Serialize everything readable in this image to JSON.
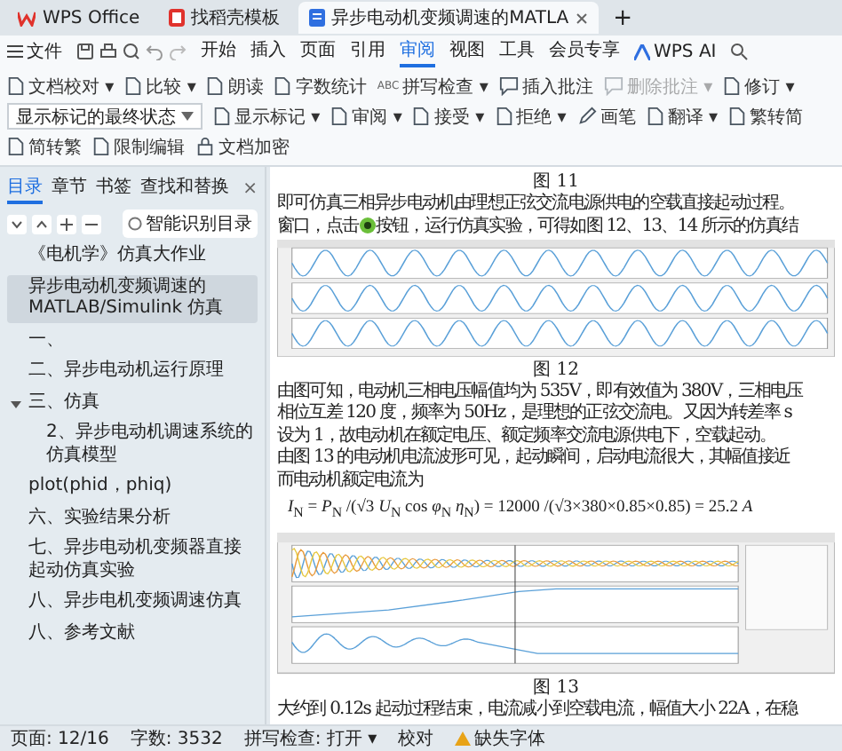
{
  "tabs": [
    {
      "kind": "home",
      "label": "WPS Office",
      "selected": false
    },
    {
      "kind": "template",
      "label": "找稻壳模板",
      "selected": false
    },
    {
      "kind": "document",
      "label": "异步电动机变频调速的MATLA",
      "selected": true
    }
  ],
  "tab_add": "+",
  "menu": {
    "file": "文件",
    "items": [
      {
        "label": "开始",
        "selected": false
      },
      {
        "label": "插入",
        "selected": false
      },
      {
        "label": "页面",
        "selected": false
      },
      {
        "label": "引用",
        "selected": false
      },
      {
        "label": "审阅",
        "selected": true
      },
      {
        "label": "视图",
        "selected": false
      },
      {
        "label": "工具",
        "selected": false
      },
      {
        "label": "会员专享",
        "selected": false
      }
    ],
    "ai": "WPS AI"
  },
  "ribbon": [
    {
      "kind": "button",
      "label": "文档校对 ▾",
      "disabled": false
    },
    {
      "kind": "button",
      "label": "比较 ▾",
      "disabled": false
    },
    {
      "kind": "button",
      "label": "朗读",
      "disabled": false
    },
    {
      "kind": "button",
      "label": "字数统计",
      "disabled": false
    },
    {
      "kind": "abc",
      "icon_text": "ABC",
      "label": "拼写检查 ▾",
      "disabled": false
    },
    {
      "kind": "comment",
      "label": "插入批注",
      "disabled": false
    },
    {
      "kind": "comment",
      "label": "删除批注 ▾",
      "disabled": true
    },
    {
      "kind": "button",
      "label": "修订 ▾",
      "disabled": false
    },
    {
      "kind": "select",
      "value": "显示标记的最终状态"
    },
    {
      "kind": "button",
      "label": "显示标记 ▾",
      "disabled": false
    },
    {
      "kind": "button",
      "label": "审阅 ▾",
      "disabled": false
    },
    {
      "kind": "button",
      "label": "接受 ▾",
      "disabled": false
    },
    {
      "kind": "button",
      "label": "拒绝 ▾",
      "disabled": false
    },
    {
      "kind": "pen",
      "label": "画笔",
      "disabled": false
    },
    {
      "kind": "button",
      "label": "翻译 ▾",
      "disabled": false
    },
    {
      "kind": "button",
      "label": "繁转简",
      "disabled": false
    },
    {
      "kind": "button",
      "label": "简转繁",
      "disabled": false
    },
    {
      "kind": "button",
      "label": "限制编辑",
      "disabled": false
    },
    {
      "kind": "lock",
      "label": "文档加密",
      "disabled": false
    }
  ],
  "nav": {
    "tabs": [
      {
        "label": "目录",
        "selected": true
      },
      {
        "label": "章节",
        "selected": false
      },
      {
        "label": "书签",
        "selected": false
      },
      {
        "label": "查找和替换",
        "selected": false
      }
    ],
    "close": "×",
    "smart_toc": "智能识别目录",
    "items": [
      {
        "label": "《电机学》仿真大作业",
        "selected": false,
        "expanded": false
      },
      {
        "label": "异步电动机变频调速的 MATLAB/Simulink 仿真",
        "selected": true,
        "expanded": false
      },
      {
        "label": "一、",
        "selected": false,
        "expanded": false
      },
      {
        "label": "二、异步电动机运行原理",
        "selected": false,
        "expanded": false
      },
      {
        "label": "三、仿真",
        "selected": false,
        "expanded": true,
        "children": [
          {
            "label": "2、异步电动机调速系统的仿真模型",
            "selected": false,
            "expanded": false
          }
        ]
      },
      {
        "label": "plot(phid，phiq)",
        "selected": false,
        "expanded": false
      },
      {
        "label": "六、实验结果分析",
        "selected": false,
        "expanded": false
      },
      {
        "label": "七、异步电动机变频器直接起动仿真实验",
        "selected": false,
        "expanded": false
      },
      {
        "label": "八、异步电机变频调速仿真",
        "selected": false,
        "expanded": false
      },
      {
        "label": "八、参考文献",
        "selected": false,
        "expanded": false
      }
    ]
  },
  "doc": {
    "blocks": [
      {
        "kind": "caption",
        "text": "图 11"
      },
      {
        "kind": "text",
        "text": "即可仿真三相异步电动机由理想正弦交流电源供电的空载直接起动过程。"
      },
      {
        "kind": "run_line",
        "before": "窗口，点击",
        "after": "按钮，运行仿真实验，可得如图 12、13、14 所示的仿真结"
      },
      {
        "kind": "scope_sine"
      },
      {
        "kind": "caption",
        "text": "图 12"
      },
      {
        "kind": "text",
        "text": "由图可知，电动机三相电压幅值均为 535V，即有效值为 380V，三相电压"
      },
      {
        "kind": "text",
        "text": "相位互差 120 度，频率为 50Hz，是理想的正弦交流电。又因为转差率 s"
      },
      {
        "kind": "text",
        "text": "设为 1，故电动机在额定电压、额定频率交流电源供电下，空载起动。"
      },
      {
        "kind": "text",
        "text": "由图 13 的电动机电流波形可见，起动瞬间，启动电流很大，其幅值接近"
      },
      {
        "kind": "text",
        "text": "而电动机额定电流为"
      },
      {
        "kind": "formula",
        "text": "*I*$_{N}$ = *P*$_{N}$ /(√3 *U*$_{N}$ cos *φ*$_{N}$ *η*$_{N}$) = 12000 /(√3×380×0.85×0.85) = 25.2 *A*"
      },
      {
        "kind": "scope_start"
      },
      {
        "kind": "caption",
        "text": "图 13"
      },
      {
        "kind": "text",
        "text": "大约到 0.12s 起动过程结束，电流减小到空载电流，幅值大小 22A，在稳"
      }
    ]
  },
  "status": {
    "items": [
      "页面: 12/16",
      "字数: 3532",
      "拼写检查: 打开 ▾",
      "校对"
    ],
    "warning": "缺失字体"
  }
}
